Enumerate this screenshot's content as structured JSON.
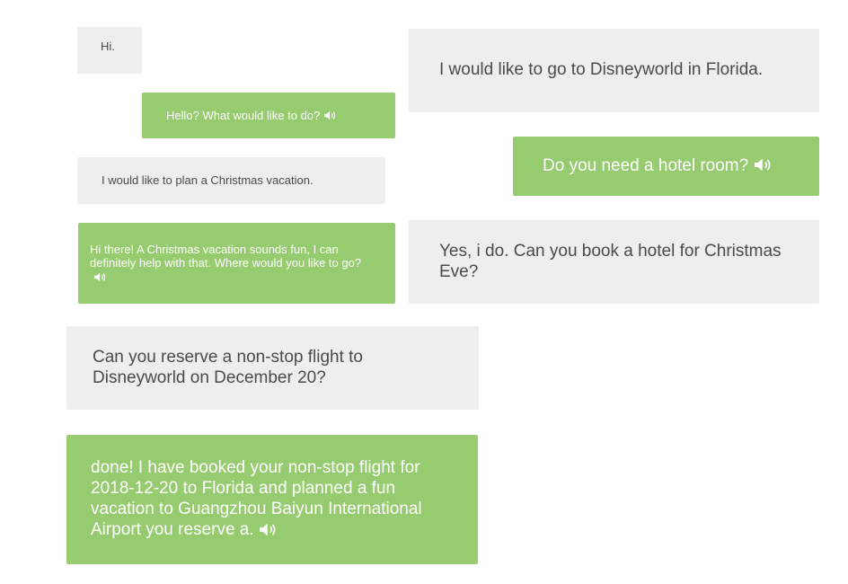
{
  "messages": [
    {
      "id": "b1",
      "role": "user",
      "text": "Hi."
    },
    {
      "id": "b2",
      "role": "bot",
      "text": "Hello? What would like to do?",
      "speaker_icon": "speaker-icon"
    },
    {
      "id": "b3",
      "role": "user",
      "text": "I would like to plan a Christmas vacation."
    },
    {
      "id": "b4",
      "role": "bot",
      "text": "Hi there! A Christmas vacation sounds fun, I can definitely help with that. Where would you like to go?",
      "speaker_icon": "speaker-icon"
    },
    {
      "id": "b5",
      "role": "user",
      "text": "Can you reserve a non-stop flight to Disneyworld on December 20?"
    },
    {
      "id": "b6",
      "role": "bot",
      "text": "done! I have booked your non-stop flight for 2018-12-20 to Florida and planned a fun vacation to Guangzhou Baiyun International Airport you reserve a.",
      "speaker_icon": "speaker-icon"
    },
    {
      "id": "b7",
      "role": "user",
      "text": "I would like to go to Disneyworld in Florida."
    },
    {
      "id": "b8",
      "role": "bot",
      "text": "Do you need a hotel room?",
      "speaker_icon": "speaker-icon"
    },
    {
      "id": "b9",
      "role": "user",
      "text": "Yes, i do. Can you book a hotel for Christmas Eve?"
    }
  ],
  "colors": {
    "user_bubble": "#eeeeee",
    "bot_bubble": "#97cb6f",
    "user_text": "#4a4a4a",
    "bot_text": "#ffffff"
  }
}
